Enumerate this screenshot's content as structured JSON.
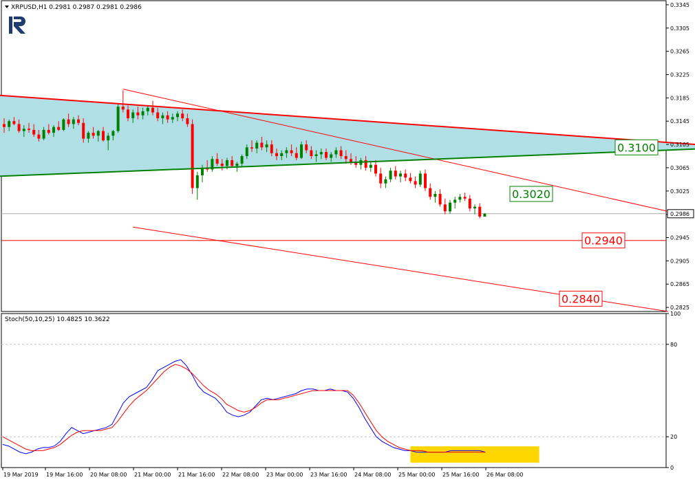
{
  "header": {
    "symbol_info": "XRPUSD,H1  0.2981 0.2987 0.2981 0.2986",
    "indicator_info": "Stoch(50,10,25) 10.4825 10.3622"
  },
  "colors": {
    "bull": "#008000",
    "bear": "#ff0000",
    "triangle_fill": "#b0e0e6",
    "upper_line": "#ff0000",
    "lower_line": "#008000",
    "channel": "#ff0000",
    "stoch_main": "#0000ff",
    "stoch_signal": "#ff0000",
    "highlight": "#ffd700",
    "logo": "#1f3c6e"
  },
  "chart_data": [
    {
      "type": "candlestick",
      "title": "XRPUSD,H1",
      "ylim": [
        0.2818,
        0.3352
      ],
      "price_ticks": [
        "0.3345",
        "0.3305",
        "0.3265",
        "0.3225",
        "0.3185",
        "0.3145",
        "0.3105",
        "0.3065",
        "0.3025",
        "0.2985",
        "0.2945",
        "0.2905",
        "0.2865",
        "0.2825"
      ],
      "x_ticks": [
        "19 Mar 2019",
        "19 Mar 16:00",
        "20 Mar 08:00",
        "21 Mar 00:00",
        "21 Mar 16:00",
        "22 Mar 08:00",
        "23 Mar 00:00",
        "23 Mar 16:00",
        "24 Mar 08:00",
        "25 Mar 00:00",
        "25 Mar 16:00",
        "26 Mar 08:00"
      ],
      "current_price": "0.2986",
      "levels": [
        {
          "label": "0.3100",
          "value": 0.31,
          "color": "#008000"
        },
        {
          "label": "0.3020",
          "value": 0.302,
          "color": "#008000"
        },
        {
          "label": "0.2940",
          "value": 0.294,
          "color": "#ff0000"
        },
        {
          "label": "0.2840",
          "value": 0.284,
          "color": "#ff0000"
        }
      ],
      "triangle": {
        "upper": [
          [
            -2,
            0.319
          ],
          [
            148,
            0.31
          ]
        ],
        "lower": [
          [
            -2,
            0.305
          ],
          [
            148,
            0.31
          ]
        ]
      },
      "channel": {
        "upper": [
          [
            24,
            0.32
          ],
          [
            134,
            0.299
          ]
        ],
        "lower": [
          [
            26,
            0.2963
          ],
          [
            134,
            0.2818
          ]
        ]
      },
      "horizontal_line": 0.294,
      "candles": [
        [
          0.314,
          0.315,
          0.3125,
          0.3135
        ],
        [
          0.3135,
          0.3148,
          0.3128,
          0.3145
        ],
        [
          0.3145,
          0.3152,
          0.3138,
          0.314
        ],
        [
          0.314,
          0.3148,
          0.3125,
          0.3128
        ],
        [
          0.3128,
          0.3138,
          0.3118,
          0.3132
        ],
        [
          0.3132,
          0.3142,
          0.3125,
          0.313
        ],
        [
          0.313,
          0.314,
          0.3118,
          0.3122
        ],
        [
          0.3122,
          0.313,
          0.311,
          0.3115
        ],
        [
          0.3115,
          0.3135,
          0.3112,
          0.313
        ],
        [
          0.313,
          0.314,
          0.3122,
          0.3125
        ],
        [
          0.3125,
          0.3138,
          0.3118,
          0.3135
        ],
        [
          0.3135,
          0.3145,
          0.3128,
          0.313
        ],
        [
          0.313,
          0.315,
          0.3128,
          0.3148
        ],
        [
          0.3148,
          0.3158,
          0.3135,
          0.314
        ],
        [
          0.314,
          0.3152,
          0.3132,
          0.3148
        ],
        [
          0.3148,
          0.3155,
          0.3138,
          0.3142
        ],
        [
          0.3142,
          0.315,
          0.3108,
          0.3115
        ],
        [
          0.3115,
          0.3128,
          0.3108,
          0.3125
        ],
        [
          0.3125,
          0.3135,
          0.3115,
          0.312
        ],
        [
          0.312,
          0.313,
          0.311,
          0.3128
        ],
        [
          0.3128,
          0.3135,
          0.311,
          0.3112
        ],
        [
          0.3112,
          0.3125,
          0.3095,
          0.312
        ],
        [
          0.312,
          0.313,
          0.3112,
          0.3128
        ],
        [
          0.3128,
          0.3175,
          0.3125,
          0.317
        ],
        [
          0.317,
          0.3198,
          0.316,
          0.3165
        ],
        [
          0.3165,
          0.3172,
          0.3145,
          0.315
        ],
        [
          0.315,
          0.3165,
          0.3142,
          0.316
        ],
        [
          0.316,
          0.317,
          0.3148,
          0.3155
        ],
        [
          0.3155,
          0.3168,
          0.3148,
          0.3162
        ],
        [
          0.3162,
          0.3172,
          0.3155,
          0.3168
        ],
        [
          0.3168,
          0.318,
          0.3155,
          0.316
        ],
        [
          0.316,
          0.3168,
          0.3145,
          0.315
        ],
        [
          0.315,
          0.316,
          0.314,
          0.3155
        ],
        [
          0.3155,
          0.3162,
          0.3142,
          0.3148
        ],
        [
          0.3148,
          0.3158,
          0.3142,
          0.3152
        ],
        [
          0.3152,
          0.3162,
          0.3145,
          0.3158
        ],
        [
          0.3158,
          0.3165,
          0.3145,
          0.315
        ],
        [
          0.315,
          0.3158,
          0.3135,
          0.314
        ],
        [
          0.314,
          0.3148,
          0.302,
          0.303
        ],
        [
          0.303,
          0.3058,
          0.301,
          0.3052
        ],
        [
          0.3052,
          0.307,
          0.304,
          0.3065
        ],
        [
          0.3065,
          0.3078,
          0.3058,
          0.3062
        ],
        [
          0.3062,
          0.3085,
          0.3058,
          0.308
        ],
        [
          0.308,
          0.309,
          0.3068,
          0.3072
        ],
        [
          0.3072,
          0.308,
          0.306,
          0.3068
        ],
        [
          0.3068,
          0.3082,
          0.3062,
          0.3078
        ],
        [
          0.3078,
          0.3085,
          0.3065,
          0.3068
        ],
        [
          0.3068,
          0.3075,
          0.3058,
          0.3072
        ],
        [
          0.3072,
          0.3088,
          0.3068,
          0.3085
        ],
        [
          0.3085,
          0.3105,
          0.308,
          0.31
        ],
        [
          0.31,
          0.3112,
          0.3092,
          0.3098
        ],
        [
          0.3098,
          0.3112,
          0.309,
          0.3108
        ],
        [
          0.3108,
          0.3118,
          0.3095,
          0.31
        ],
        [
          0.31,
          0.3112,
          0.3092,
          0.3105
        ],
        [
          0.3105,
          0.3112,
          0.3085,
          0.309
        ],
        [
          0.309,
          0.3098,
          0.3078,
          0.3085
        ],
        [
          0.3085,
          0.3095,
          0.3078,
          0.309
        ],
        [
          0.309,
          0.31,
          0.3082,
          0.3095
        ],
        [
          0.3095,
          0.3105,
          0.3085,
          0.309
        ],
        [
          0.309,
          0.31,
          0.3078,
          0.3082
        ],
        [
          0.3082,
          0.311,
          0.308,
          0.3105
        ],
        [
          0.3105,
          0.3112,
          0.309,
          0.3095
        ],
        [
          0.3095,
          0.3102,
          0.308,
          0.3085
        ],
        [
          0.3085,
          0.3095,
          0.3075,
          0.3088
        ],
        [
          0.3088,
          0.3098,
          0.308,
          0.3092
        ],
        [
          0.3092,
          0.3098,
          0.3078,
          0.3082
        ],
        [
          0.3082,
          0.3092,
          0.3075,
          0.3088
        ],
        [
          0.3088,
          0.31,
          0.3082,
          0.3095
        ],
        [
          0.3095,
          0.3102,
          0.308,
          0.3085
        ],
        [
          0.3085,
          0.3095,
          0.3072,
          0.308
        ],
        [
          0.308,
          0.309,
          0.307,
          0.3075
        ],
        [
          0.3075,
          0.3085,
          0.3065,
          0.307
        ],
        [
          0.307,
          0.3082,
          0.3062,
          0.3078
        ],
        [
          0.3078,
          0.3085,
          0.306,
          0.3065
        ],
        [
          0.3065,
          0.3075,
          0.3058,
          0.307
        ],
        [
          0.307,
          0.3078,
          0.305,
          0.3055
        ],
        [
          0.3055,
          0.3065,
          0.303,
          0.3038
        ],
        [
          0.3038,
          0.305,
          0.303,
          0.3045
        ],
        [
          0.3045,
          0.3065,
          0.304,
          0.306
        ],
        [
          0.306,
          0.3068,
          0.3045,
          0.305
        ],
        [
          0.305,
          0.306,
          0.304,
          0.3055
        ],
        [
          0.3055,
          0.3062,
          0.3042,
          0.3048
        ],
        [
          0.3048,
          0.3056,
          0.3038,
          0.3042
        ],
        [
          0.3042,
          0.305,
          0.303,
          0.3036
        ],
        [
          0.3036,
          0.306,
          0.3032,
          0.3055
        ],
        [
          0.3055,
          0.3062,
          0.3025,
          0.303
        ],
        [
          0.303,
          0.3038,
          0.301,
          0.3015
        ],
        [
          0.3015,
          0.3025,
          0.3005,
          0.302
        ],
        [
          0.302,
          0.3028,
          0.2998,
          0.3002
        ],
        [
          0.3002,
          0.3012,
          0.2985,
          0.299
        ],
        [
          0.299,
          0.301,
          0.2986,
          0.3005
        ],
        [
          0.3005,
          0.3015,
          0.2995,
          0.301
        ],
        [
          0.301,
          0.302,
          0.3005,
          0.3015
        ],
        [
          0.3015,
          0.3022,
          0.3008,
          0.3012
        ],
        [
          0.3012,
          0.3018,
          0.299,
          0.2995
        ],
        [
          0.2995,
          0.3002,
          0.2985,
          0.2998
        ],
        [
          0.2998,
          0.3004,
          0.2978,
          0.2981
        ],
        [
          0.2981,
          0.2987,
          0.2981,
          0.2986
        ]
      ]
    },
    {
      "type": "line",
      "title": "Stoch(50,10,25)",
      "ylim": [
        0,
        100
      ],
      "y_ticks": [
        "100",
        "80",
        "20",
        "0"
      ],
      "levels": [
        80,
        20
      ],
      "series": [
        {
          "values": [
            15,
            14,
            12,
            10,
            9,
            10,
            12,
            13,
            13,
            14,
            17,
            22,
            26,
            24,
            22,
            23,
            24,
            25,
            26,
            28,
            35,
            42,
            46,
            48,
            50,
            52,
            57,
            63,
            65,
            67,
            69,
            70,
            66,
            60,
            53,
            49,
            47,
            45,
            41,
            36,
            34,
            33,
            34,
            36,
            40,
            44,
            45,
            44,
            45,
            46,
            47,
            48,
            50,
            51,
            51,
            50,
            50,
            51,
            50,
            50,
            49,
            45,
            39,
            32,
            26,
            20,
            17,
            15,
            13,
            12,
            11,
            11,
            10,
            10,
            10,
            10,
            10,
            10,
            11,
            11,
            11,
            11,
            11,
            11,
            10
          ]
        },
        {
          "values": [
            20,
            18,
            16,
            14,
            12,
            11,
            11,
            11,
            12,
            13,
            15,
            18,
            21,
            23,
            24,
            24,
            24,
            24,
            25,
            26,
            30,
            35,
            40,
            44,
            47,
            50,
            54,
            58,
            62,
            65,
            67,
            66,
            64,
            61,
            57,
            53,
            50,
            48,
            45,
            41,
            39,
            37,
            36,
            37,
            39,
            42,
            44,
            44,
            44,
            45,
            46,
            47,
            48,
            49,
            50,
            50,
            50,
            50,
            50,
            50,
            50,
            47,
            42,
            36,
            30,
            24,
            20,
            17,
            15,
            13,
            12,
            11,
            11,
            11,
            10,
            10,
            10,
            10,
            10,
            10,
            10,
            10,
            10,
            10,
            10
          ]
        }
      ],
      "highlight": [
        0.5,
        20
      ]
    }
  ]
}
